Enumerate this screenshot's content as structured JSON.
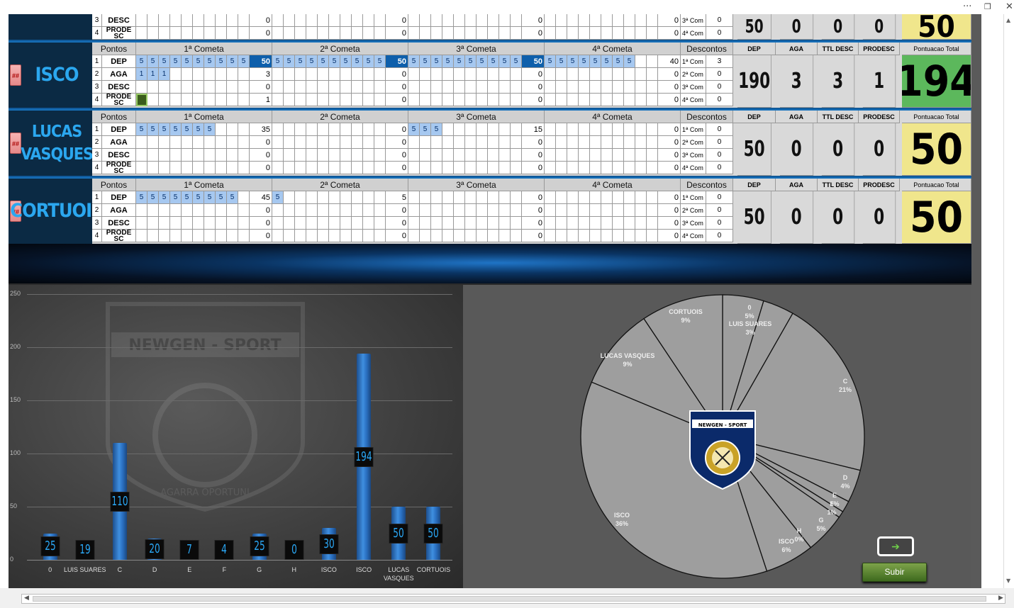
{
  "window": {
    "more_glyph": "···",
    "restore_glyph": "❒",
    "close_glyph": "✕"
  },
  "players_top": {
    "partial": {
      "rows": [
        {
          "n": "3",
          "label": "DESC",
          "vals": [
            "0",
            "0",
            "0",
            "0"
          ]
        },
        {
          "n": "4",
          "label": "PRODE SC",
          "vals": [
            "0",
            "0",
            "0",
            "0"
          ]
        }
      ],
      "desc": [
        {
          "name": "3ª Com",
          "val": "0"
        },
        {
          "name": "4ª Com",
          "val": "0"
        }
      ],
      "dep": "50",
      "aga": "0",
      "ttl": "0",
      "prodesc": "0",
      "total": "50"
    }
  },
  "headers": {
    "pontos": "Pontos",
    "c1": "1ª Cometa",
    "c2": "2ª Cometa",
    "c3": "3ª Cometa",
    "c4": "4ª Cometa",
    "descontos": "Descontos",
    "dep": "DEP",
    "aga": "AGA",
    "ttl": "TTL DESC",
    "prodesc": "PRODESC",
    "total": "Pontuacao Total"
  },
  "row_labels": [
    "DEP",
    "AGA",
    "DESC",
    "PRODE SC"
  ],
  "desc_names": [
    "1ª Com",
    "2ª Com",
    "3ª Com",
    "4ª Com"
  ],
  "expand_glyph": "##",
  "players": [
    {
      "name": "ISCO",
      "dep": "190",
      "aga": "3",
      "ttl": "3",
      "prodesc": "1",
      "total": "194",
      "total_color": "#5cb85c",
      "rows": [
        {
          "pts": [
            [
              "5",
              "5",
              "5",
              "5",
              "5",
              "5",
              "5",
              "5",
              "5",
              "5"
            ],
            [
              "5",
              "5",
              "5",
              "5",
              "5",
              "5",
              "5",
              "5",
              "5",
              "5"
            ],
            [
              "5",
              "5",
              "5",
              "5",
              "5",
              "5",
              "5",
              "5",
              "5",
              "5"
            ],
            [
              "5",
              "5",
              "5",
              "5",
              "5",
              "5",
              "5",
              "5"
            ]
          ],
          "tots": [
            "50",
            "50",
            "50",
            "40"
          ]
        },
        {
          "pts": [
            [
              "1",
              "1",
              "1"
            ],
            [],
            [],
            []
          ],
          "tots": [
            "3",
            "0",
            "0",
            "0"
          ]
        },
        {
          "pts": [
            [],
            [],
            [],
            []
          ],
          "tots": [
            "0",
            "0",
            "0",
            "0"
          ]
        },
        {
          "pts": [
            [
              "x"
            ],
            [],
            [],
            []
          ],
          "tots": [
            "1",
            "0",
            "0",
            "0"
          ]
        }
      ],
      "desc_vals": [
        "3",
        "0",
        "0",
        "0"
      ]
    },
    {
      "name": "LUCAS VASQUES",
      "dep": "50",
      "aga": "0",
      "ttl": "0",
      "prodesc": "0",
      "total": "50",
      "total_color": "#f0e68c",
      "rows": [
        {
          "pts": [
            [
              "5",
              "5",
              "5",
              "5",
              "5",
              "5",
              "5"
            ],
            [],
            [
              "5",
              "5",
              "5"
            ],
            []
          ],
          "tots": [
            "35",
            "0",
            "15",
            "0"
          ]
        },
        {
          "pts": [
            [],
            [],
            [],
            []
          ],
          "tots": [
            "0",
            "0",
            "0",
            "0"
          ]
        },
        {
          "pts": [
            [],
            [],
            [],
            []
          ],
          "tots": [
            "0",
            "0",
            "0",
            "0"
          ]
        },
        {
          "pts": [
            [],
            [],
            [],
            []
          ],
          "tots": [
            "0",
            "0",
            "0",
            "0"
          ]
        }
      ],
      "desc_vals": [
        "0",
        "0",
        "0",
        "0"
      ]
    },
    {
      "name": "CORTUOIS",
      "dep": "50",
      "aga": "0",
      "ttl": "0",
      "prodesc": "0",
      "total": "50",
      "total_color": "#f0e68c",
      "rows": [
        {
          "pts": [
            [
              "5",
              "5",
              "5",
              "5",
              "5",
              "5",
              "5",
              "5",
              "5"
            ],
            [
              "5"
            ],
            [],
            []
          ],
          "tots": [
            "45",
            "5",
            "0",
            "0"
          ]
        },
        {
          "pts": [
            [],
            [],
            [],
            []
          ],
          "tots": [
            "0",
            "0",
            "0",
            "0"
          ]
        },
        {
          "pts": [
            [],
            [],
            [],
            []
          ],
          "tots": [
            "0",
            "0",
            "0",
            "0"
          ]
        },
        {
          "pts": [
            [],
            [],
            [],
            []
          ],
          "tots": [
            "0",
            "0",
            "0",
            "0"
          ]
        }
      ],
      "desc_vals": [
        "0",
        "0",
        "0",
        "0"
      ]
    }
  ],
  "watermark": {
    "brand": "NEWGEN - SPORT",
    "motto": "AGARRA OPORTUNI"
  },
  "chart_data": [
    {
      "type": "bar",
      "categories": [
        "0",
        "LUIS SUARES",
        "C",
        "D",
        "E",
        "F",
        "G",
        "H",
        "ISCO",
        "ISCO",
        "LUCAS VASQUES",
        "CORTUOIS"
      ],
      "values": [
        25,
        19,
        110,
        20,
        7,
        4,
        25,
        0,
        30,
        194,
        50,
        50
      ],
      "y_tick_labels": [
        "0",
        "50",
        "100",
        "150",
        "200",
        "250"
      ],
      "ylim": [
        0,
        250
      ]
    },
    {
      "type": "pie",
      "slices": [
        {
          "label": "0",
          "pct": "5%",
          "value": 25
        },
        {
          "label": "LUIS SUARES",
          "pct": "3%",
          "value": 19
        },
        {
          "label": "C",
          "pct": "21%",
          "value": 110
        },
        {
          "label": "D",
          "pct": "4%",
          "value": 20
        },
        {
          "label": "E",
          "pct": "1%",
          "value": 7
        },
        {
          "label": "F",
          "pct": "1%",
          "value": 4
        },
        {
          "label": "G",
          "pct": "5%",
          "value": 25
        },
        {
          "label": "H",
          "pct": "0%",
          "value": 0
        },
        {
          "label": "ISCO",
          "pct": "6%",
          "value": 30
        },
        {
          "label": "ISCO",
          "pct": "36%",
          "value": 194
        },
        {
          "label": "LUCAS VASQUES",
          "pct": "9%",
          "value": 50
        },
        {
          "label": "CORTUOIS",
          "pct": "9%",
          "value": 50
        }
      ],
      "center_logo_text": "NEWGEN - SPORT"
    }
  ],
  "buttons": {
    "nav_arrow": "➔",
    "subir": "Subir"
  },
  "colors": {
    "accent": "#2ba7ef",
    "header_blue": "#0b2a44",
    "pie_slice": "#9e9e9e"
  }
}
